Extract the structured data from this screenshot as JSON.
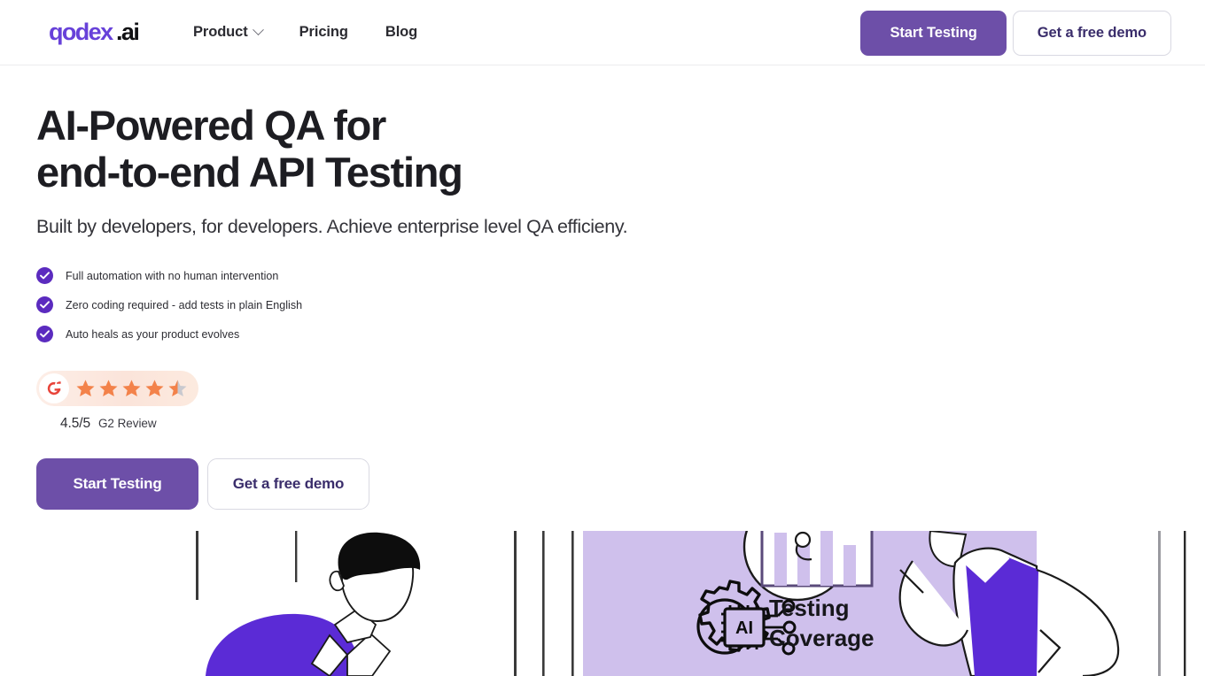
{
  "brand": {
    "logo_text": "qodex.ai",
    "logo_name_color": "#6741d9",
    "logo_suffix_color": "#111114",
    "accent_purple": "#6d4fa8",
    "bullet_purple": "#5b2bbf",
    "illustration_purple": "#5b2bd6",
    "illustration_lavender": "#cfc0ec",
    "star_orange": "#f3824a",
    "star_grey": "#c9c9cf",
    "g2_red": "#e8443a"
  },
  "nav": {
    "links": [
      {
        "label": "Product",
        "has_dropdown": true,
        "icon": "chevron-down-icon"
      },
      {
        "label": "Pricing",
        "has_dropdown": false
      },
      {
        "label": "Blog",
        "has_dropdown": false
      }
    ],
    "primary_cta": "Start Testing",
    "secondary_cta": "Get a free demo"
  },
  "hero": {
    "title": "AI-Powered QA for\nend-to-end API Testing",
    "subtitle": "Built by developers, for developers. Achieve enterprise level QA efficieny.",
    "bullets": [
      {
        "icon": "check-circle-icon",
        "text": "Full automation with no human intervention"
      },
      {
        "icon": "check-circle-icon",
        "text": "Zero coding required - add tests in plain English"
      },
      {
        "icon": "check-circle-icon",
        "text": "Auto heals as your product evolves"
      }
    ],
    "rating": {
      "badge_icon": "g2-logo-icon",
      "stars_total": 5,
      "stars_filled": 4,
      "stars_half": 1,
      "score": "4.5/5",
      "source": "G2 Review"
    },
    "primary_cta": "Start Testing",
    "secondary_cta": "Get a free demo"
  },
  "illustration": {
    "name": "qa-testing-dashboard-illustration",
    "panel_label_line1": "Testing",
    "panel_label_line2": "Coverage",
    "ai_chip_label": "AI"
  }
}
